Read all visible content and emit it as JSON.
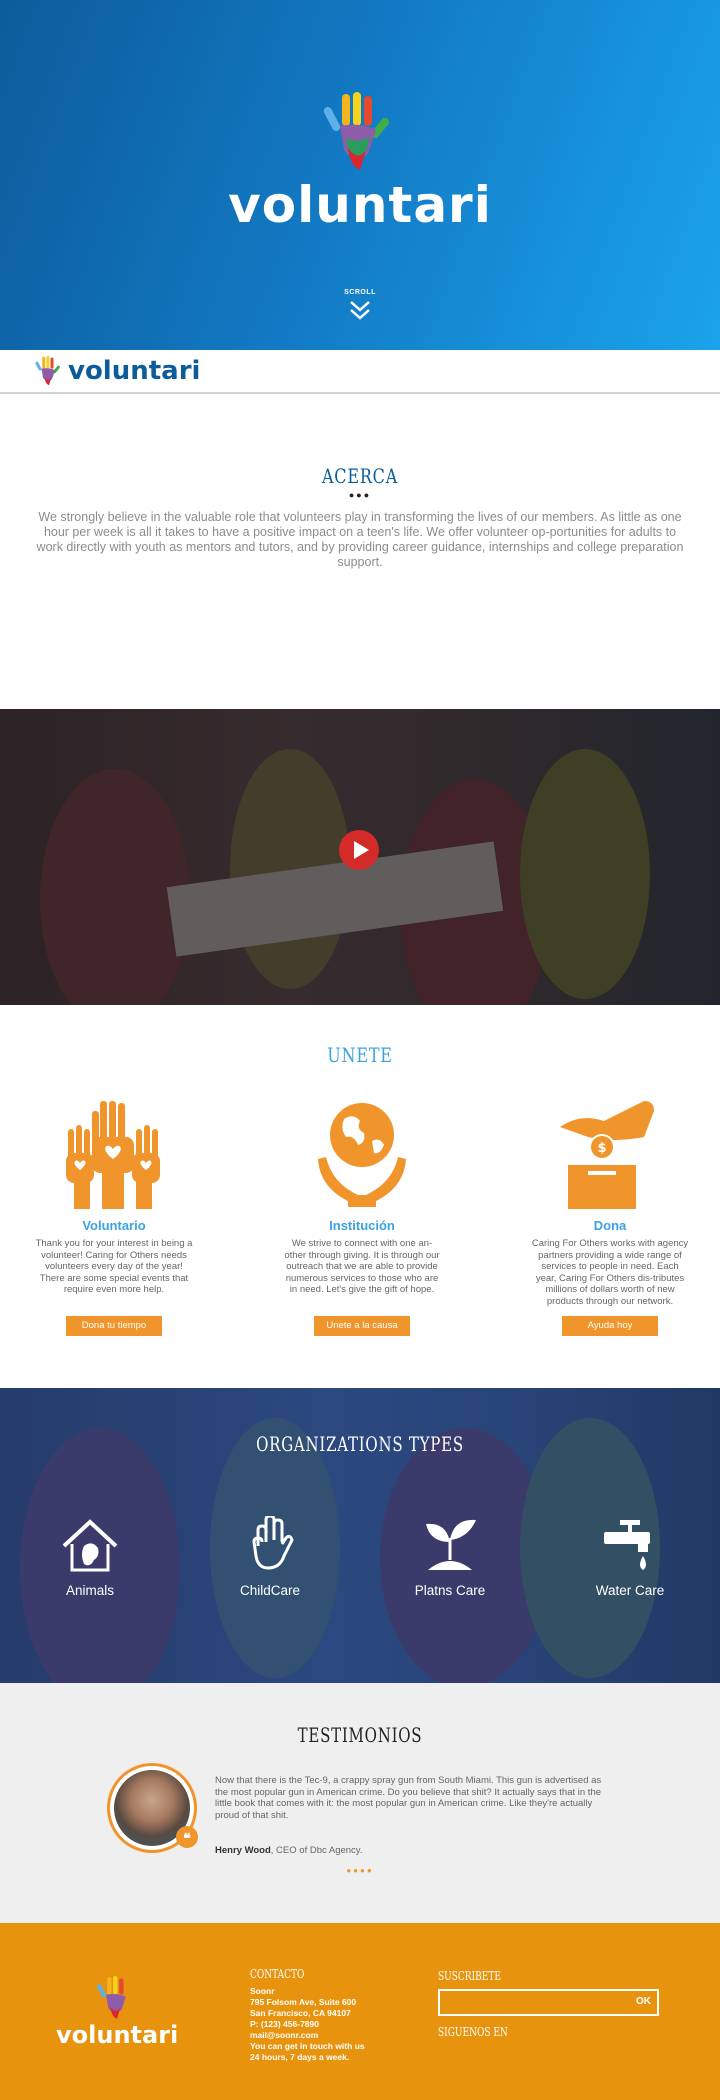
{
  "hero": {
    "brand": "voluntari",
    "scroll_label": "SCROLL"
  },
  "nav": {
    "brand": "voluntari"
  },
  "about": {
    "title": "ACERCA",
    "dots": "●●●",
    "text": "We strongly believe in the valuable role that volunteers play in transforming the lives of our members. As little as one hour per week is all it takes to have a positive impact on a teen's life. We offer volunteer op-portunities for adults to work directly with youth as mentors and tutors, and by providing career guidance, internships and college preparation support."
  },
  "join": {
    "title": "UNETE",
    "cards": [
      {
        "icon": "raised-hands-hearts-icon",
        "title": "Voluntario",
        "text": "Thank you for your interest in being a volunteer! Caring for Others needs volunteers every day of the year! There are some special events that require even more help.",
        "button": "Dona tu tiempo"
      },
      {
        "icon": "hands-globe-icon",
        "title": "Institución",
        "text": "We strive to connect with one an-other through giving. It is through our outreach that we are able to provide numerous services to those who are in need. Let's give the gift of hope.",
        "button": "Unete a la causa"
      },
      {
        "icon": "donation-box-icon",
        "title": "Dona",
        "text": "Caring For Others works with agency partners providing a wide range of services to people in need. Each year, Caring For Others dis-tributes millions of dollars worth of new products through our network.",
        "button": "Ayuda hoy"
      }
    ]
  },
  "orgs": {
    "title": "ORGANIZATIONS TYPES",
    "items": [
      {
        "icon": "animal-shelter-icon",
        "label": "Animals"
      },
      {
        "icon": "raised-hand-icon",
        "label": "ChildCare"
      },
      {
        "icon": "plant-sprout-icon",
        "label": "Platns Care"
      },
      {
        "icon": "water-tap-icon",
        "label": "Water Care"
      }
    ]
  },
  "testimonials": {
    "title": "TESTIMONIOS",
    "quote": "Now that there is the Tec-9, a crappy spray gun from South Miami. This gun is advertised as the most popular gun in American crime. Do you believe that shit? It actually says that in the little book that comes with it: the most popular gun in American crime. Like they're actually proud of that shit.",
    "author_name": "Henry Wood",
    "author_role": ", CEO of Dbc Agency.",
    "dots": "●●●●"
  },
  "footer": {
    "brand": "voluntari",
    "contact_title": "CONTACTO",
    "contact_lines": [
      "Soonr",
      "795 Folsom Ave, Suite 600",
      "San Francisco, CA 94107",
      "P: (123) 456-7890",
      "mail@soonr.com",
      "You can get in touch with us",
      "24 hours, 7 days a week."
    ],
    "subscribe_title": "SUSCRIBETE",
    "subscribe_button": "OK",
    "follow_title": "SIGUENOS EN"
  },
  "colors": {
    "blue": "#0c5c9a",
    "light_blue": "#3aa3e2",
    "orange": "#f0952b",
    "footer_orange": "#e8930e"
  }
}
